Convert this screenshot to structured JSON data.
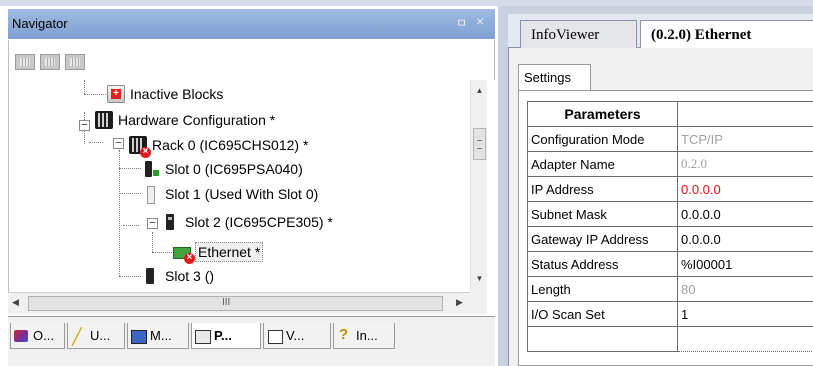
{
  "navigator": {
    "title": "Navigator",
    "pin_glyph": "ㅁ",
    "close_glyph": "×",
    "tree": [
      {
        "label": "Inactive Blocks",
        "icon": "inactive-blocks-folder-icon"
      },
      {
        "label": "Hardware Configuration *",
        "icon": "hardware-config-icon"
      },
      {
        "label": "Rack 0 (IC695CHS012) *",
        "icon": "rack-error-icon"
      },
      {
        "label": "Slot 0 (IC695PSA040)",
        "icon": "power-supply-icon"
      },
      {
        "label": "Slot 1 (Used With Slot 0)",
        "icon": "empty-slot-icon"
      },
      {
        "label": "Slot 2 (IC695CPE305) *",
        "icon": "cpu-module-icon"
      },
      {
        "label": "Ethernet *",
        "icon": "ethernet-error-icon"
      },
      {
        "label": "Slot 3 ()",
        "icon": "slot-module-icon"
      }
    ],
    "hscroll_grip": "III",
    "bottom_tabs": [
      {
        "label": "O...",
        "icon": "tab-o-icon"
      },
      {
        "label": "U...",
        "icon": "tab-u-icon"
      },
      {
        "label": "M...",
        "icon": "tab-m-icon"
      },
      {
        "label": "P...",
        "icon": "tab-p-icon"
      },
      {
        "label": "V...",
        "icon": "tab-v-icon"
      },
      {
        "label": "In...",
        "icon": "tab-in-icon"
      }
    ]
  },
  "document": {
    "tabs": [
      {
        "label": "InfoViewer"
      },
      {
        "label": "(0.2.0) Ethernet"
      }
    ],
    "settings_tab": "Settings",
    "grid": {
      "header": "Parameters",
      "rows": [
        {
          "name": "Configuration Mode",
          "value": "TCP/IP"
        },
        {
          "name": "Adapter Name",
          "value": "0.2.0"
        },
        {
          "name": "IP Address",
          "value": "0.0.0.0"
        },
        {
          "name": "Subnet Mask",
          "value": "0.0.0.0"
        },
        {
          "name": "Gateway IP Address",
          "value": "0.0.0.0"
        },
        {
          "name": "Status Address",
          "value": "%I00001"
        },
        {
          "name": "Length",
          "value": "80"
        },
        {
          "name": "I/O Scan Set",
          "value": "1"
        },
        {
          "name": "",
          "value": ""
        }
      ]
    }
  }
}
